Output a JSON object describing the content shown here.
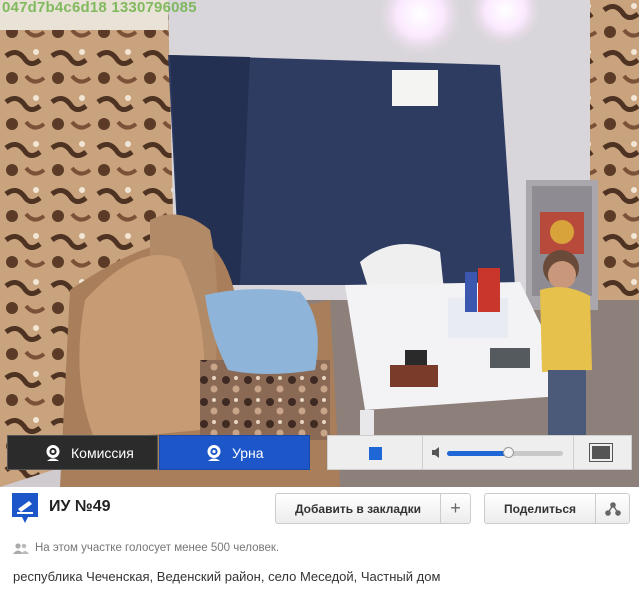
{
  "video": {
    "overlay_id": "047d7b4c6d18 1330796085"
  },
  "controls": {
    "camera_commission_label": "Комиссия",
    "camera_urn_label": "Урна",
    "active_camera": "Урна",
    "volume_level": 0.53
  },
  "station": {
    "title": "ИУ №49",
    "bookmark_label": "Добавить в закладки",
    "bookmark_plus": "+",
    "share_label": "Поделиться",
    "voters_note": "На этом участке голосует менее 500 человек.",
    "address": "республика Чеченская, Веденский район, село Меседой, Частный дом"
  },
  "colors": {
    "accent_blue": "#1d56c9",
    "dark_button": "#2b2b2b"
  }
}
